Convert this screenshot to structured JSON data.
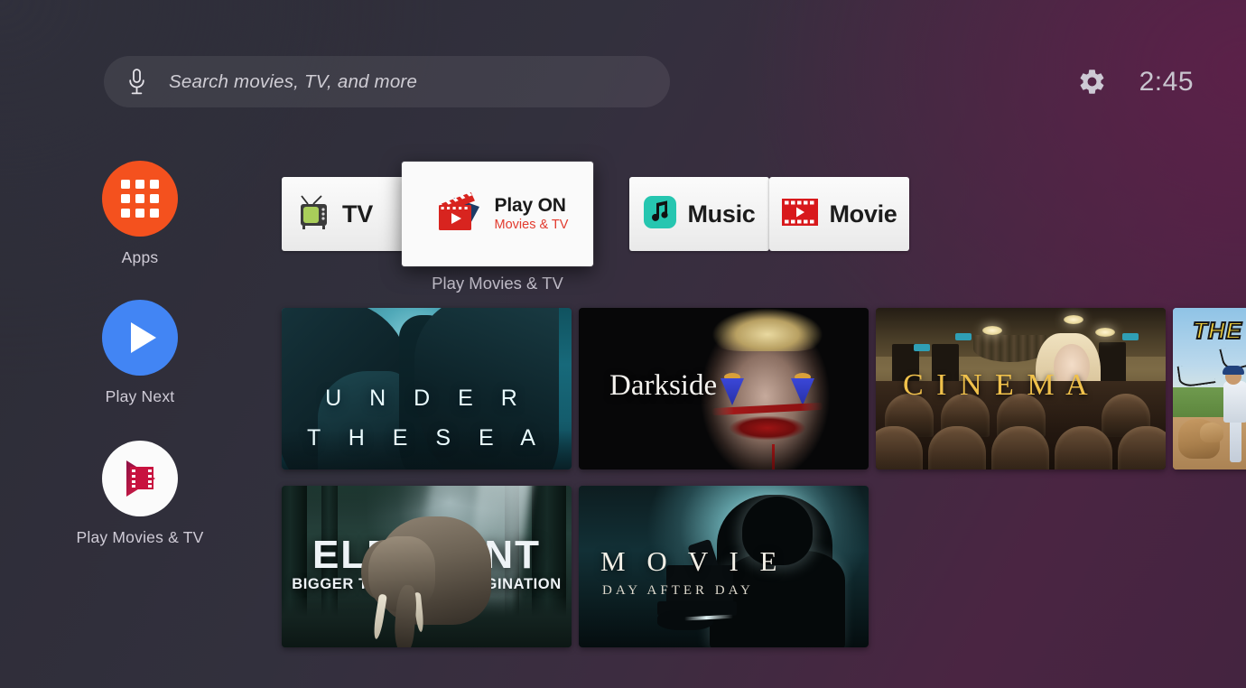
{
  "topbar": {
    "search": {
      "placeholder": "Search movies, TV, and more",
      "mic_icon": "microphone-icon"
    },
    "settings_icon": "gear-icon",
    "clock": "2:45"
  },
  "sidebar": {
    "items": [
      {
        "label": "Apps",
        "icon": "apps-grid-icon",
        "color": "#F4511E"
      },
      {
        "label": "Play Next",
        "icon": "play-triangle-icon",
        "color": "#4285F4"
      },
      {
        "label": "Play Movies & TV",
        "icon": "play-movies-logo-icon",
        "color": "#FFFFFF"
      }
    ]
  },
  "app_row": {
    "focused_label": "Play Movies & TV",
    "apps": [
      {
        "name": "TV",
        "icon": "retro-tv-icon"
      },
      {
        "name": "Play ON",
        "subtitle": "Movies & TV",
        "icon": "clapperboard-icon",
        "focused": true
      },
      {
        "name": "Music",
        "icon": "music-note-icon"
      },
      {
        "name": "Movie",
        "icon": "film-strip-play-icon"
      }
    ]
  },
  "content": {
    "rows": [
      {
        "tiles": [
          {
            "title_line1": "U N D E R",
            "title_line2": "T H E S E A",
            "art": "under-the-sea"
          },
          {
            "title": "Darkside",
            "art": "darkside"
          },
          {
            "title": "C I N E M A",
            "art": "cinema"
          },
          {
            "title": "THE",
            "art": "the-dog-baseball",
            "clipped": true
          }
        ]
      },
      {
        "tiles": [
          {
            "title": "ELEPHANT",
            "subtitle": "BIGGER THAN YOUR IMAGINATION",
            "art": "elephant"
          },
          {
            "title": "M O V I E",
            "subtitle": "DAY AFTER DAY",
            "art": "movie-day-after-day"
          }
        ]
      }
    ]
  },
  "colors": {
    "accent_red": "#E23B2E",
    "apps_orange": "#F4511E",
    "play_next_blue": "#4285F4",
    "music_teal": "#26C6B0",
    "bg_left": "#2C2C36",
    "bg_right": "#4A2542"
  }
}
